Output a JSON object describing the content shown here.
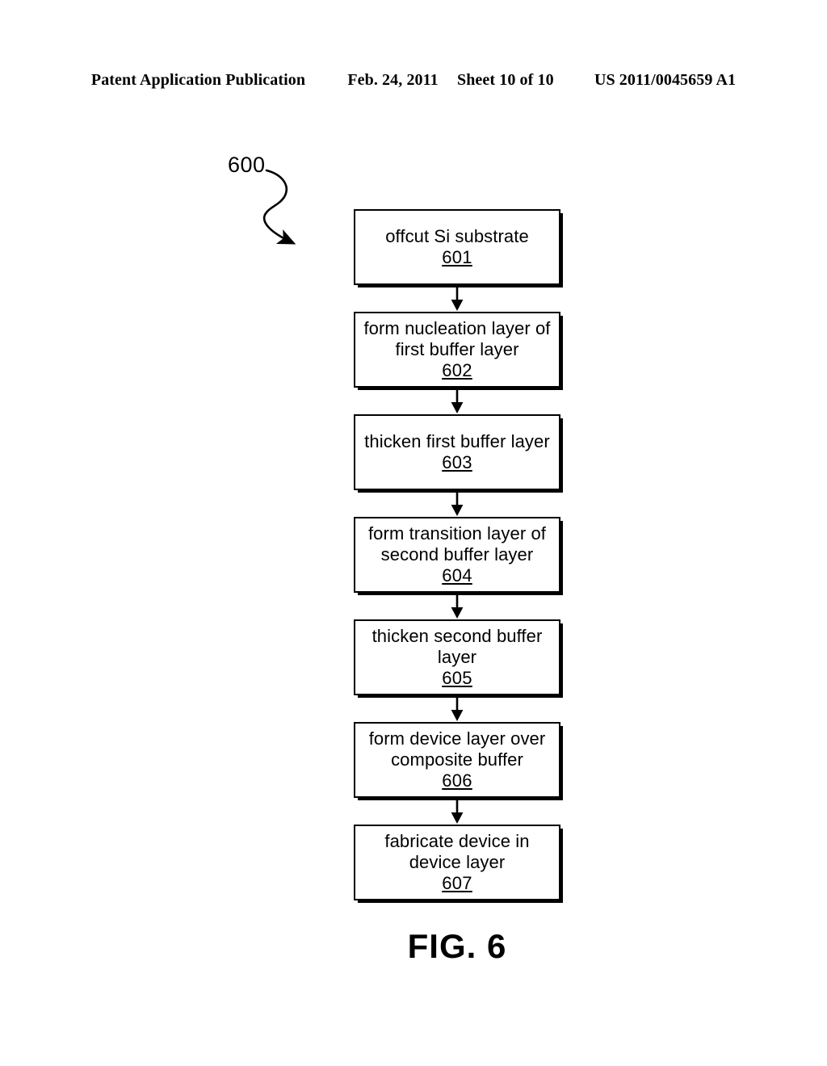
{
  "header": {
    "publication": "Patent Application Publication",
    "date": "Feb. 24, 2011",
    "sheet": "Sheet 10 of 10",
    "patent_number": "US 2011/0045659 A1"
  },
  "figure": {
    "caption": "FIG. 6",
    "reference_numeral": "600"
  },
  "flowchart": {
    "type": "process-flow",
    "orientation": "vertical",
    "steps": [
      {
        "id": "601",
        "label": "offcut Si substrate",
        "number": "601"
      },
      {
        "id": "602",
        "label": "form nucleation layer of\nfirst buffer layer",
        "number": "602"
      },
      {
        "id": "603",
        "label": "thicken first buffer layer",
        "number": "603"
      },
      {
        "id": "604",
        "label": "form transition layer of\nsecond buffer layer",
        "number": "604"
      },
      {
        "id": "605",
        "label": "thicken second buffer\nlayer",
        "number": "605"
      },
      {
        "id": "606",
        "label": "form device layer over\ncomposite buffer",
        "number": "606"
      },
      {
        "id": "607",
        "label": "fabricate device in\ndevice layer",
        "number": "607"
      }
    ],
    "connectors": [
      {
        "from": "601",
        "to": "602"
      },
      {
        "from": "602",
        "to": "603"
      },
      {
        "from": "603",
        "to": "604"
      },
      {
        "from": "604",
        "to": "605"
      },
      {
        "from": "605",
        "to": "606"
      },
      {
        "from": "606",
        "to": "607"
      }
    ]
  },
  "colors": {
    "ink": "#000000",
    "page": "#ffffff"
  }
}
